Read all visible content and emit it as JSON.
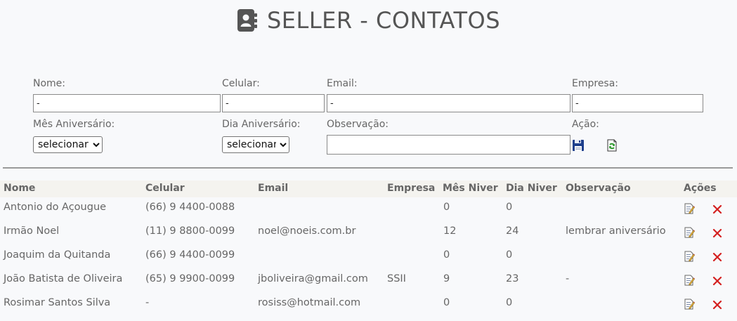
{
  "header": {
    "title": "SELLER - CONTATOS",
    "icon": "contact-book-icon"
  },
  "form": {
    "nome": {
      "label": "Nome:",
      "value": "-"
    },
    "celular": {
      "label": "Celular:",
      "value": "-"
    },
    "email": {
      "label": "Email:",
      "value": "-"
    },
    "empresa": {
      "label": "Empresa:",
      "value": "-"
    },
    "mes_aniversario": {
      "label": "Mês Aniversário:",
      "selected": "selecionar"
    },
    "dia_aniversario": {
      "label": "Dia Aniversário:",
      "selected": "selecionar"
    },
    "observacao": {
      "label": "Observação:",
      "value": ""
    },
    "acao": {
      "label": "Ação:",
      "save_icon": "floppy-save-icon",
      "refresh_icon": "refresh-icon"
    }
  },
  "table": {
    "headers": [
      "Nome",
      "Celular",
      "Email",
      "Empresa",
      "Mês Niver",
      "Dia Niver",
      "Observação",
      "Ações"
    ],
    "rows": [
      {
        "nome": "Antonio do Açougue",
        "celular": "(66) 9 4400-0088",
        "email": "",
        "empresa": "",
        "mes": "0",
        "dia": "0",
        "obs": ""
      },
      {
        "nome": "Irmão Noel",
        "celular": "(11) 9 8800-0099",
        "email": "noel@noeis.com.br",
        "empresa": "",
        "mes": "12",
        "dia": "24",
        "obs": "lembrar aniversário"
      },
      {
        "nome": "Joaquim da Quitanda",
        "celular": "(66) 9 4400-0099",
        "email": "",
        "empresa": "",
        "mes": "0",
        "dia": "0",
        "obs": ""
      },
      {
        "nome": "João Batista de Oliveira",
        "celular": "(65) 9 9900-0099",
        "email": "jboliveira@gmail.com",
        "empresa": "SSII",
        "mes": "9",
        "dia": "23",
        "obs": "-"
      },
      {
        "nome": "Rosimar Santos Silva",
        "celular": "-",
        "email": "rosiss@hotmail.com",
        "empresa": "",
        "mes": "0",
        "dia": "0",
        "obs": ""
      }
    ],
    "edit_icon": "edit-note-icon",
    "delete_icon": "delete-x-icon"
  },
  "colors": {
    "delete": "#d42020",
    "save": "#1e3f8c",
    "refresh": "#2f9a2f"
  }
}
